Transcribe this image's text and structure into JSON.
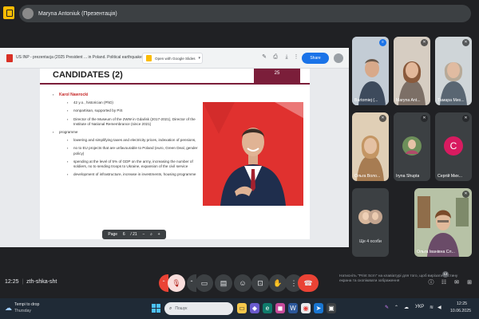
{
  "presenter": {
    "name": "Maryna Antoniuk (Презентація)"
  },
  "share": {
    "file_name": "US INP - prezentacja (2025 President ... in Poland. Political earthquake).pptx",
    "open_button": "Open with Google Slides",
    "share_button": "Share"
  },
  "slide": {
    "title": "CANDIDATES (2)",
    "corner_number": "25",
    "candidate_name": "Karol Nawrocki",
    "bullets": [
      "42 y.o., historician (PhD)",
      "nonpartisan, supported by PiS",
      "Director of the Museum of the 2WW in Gdańsk (2017-2021), Director of the Institute of National Remembrance (since 2021)"
    ],
    "programme_label": "programme",
    "programme_items": [
      "lowering and simplifying taxes and electricity prices, indexation of pensions,",
      "no to EU projects that are unfavourable to Poland (euro, Green Deal, gender policy)",
      "spending at the level of 5% of GDP on the army, increasing the number of soldiers, no to sending troops to Ukraine, expansion of the civil service",
      "development of infrastructure, increase in investments, housing programme"
    ],
    "page_label": "Page",
    "page_current": "6",
    "page_total": "/ 21"
  },
  "participants": [
    {
      "name": "Bartomiej (...",
      "bg": "#b9c3cc"
    },
    {
      "name": "Maryna Ant...",
      "bg": "#c9c1b8"
    },
    {
      "name": "Тамара Мих...",
      "bg": "#c7cdd2"
    },
    {
      "name": "Ольга Воло...",
      "bg": "#d8c3a5"
    },
    {
      "name": "Iryna Shupta",
      "bg": "#3c4043"
    },
    {
      "name": "Сергій Мих...",
      "bg": "#3c4043",
      "initial": "C"
    },
    {
      "name": "Ще 4 особи",
      "bg": "#3c4043"
    },
    {
      "name": "Ольга Іванівна Сл...",
      "bg": "#a7b39a"
    }
  ],
  "meeting": {
    "time": "12:25",
    "code": "zth-shka-sht",
    "toast": "Натисніть \"Print Scrn\" на клавіатурі для того, щоб вирізати частину екрана та скопіювати зображення",
    "chat_count": "12"
  },
  "taskbar": {
    "weather_title": "Tempi to drop",
    "weather_sub": "Thursday",
    "search_placeholder": "Пошук",
    "language": "УКР",
    "time": "12:25",
    "date": "10.06.2025"
  },
  "colors": {
    "brand": "#7b1e3a",
    "accent": "#1a73e8",
    "danger": "#ea4335",
    "candidate_name": "#c62828"
  }
}
